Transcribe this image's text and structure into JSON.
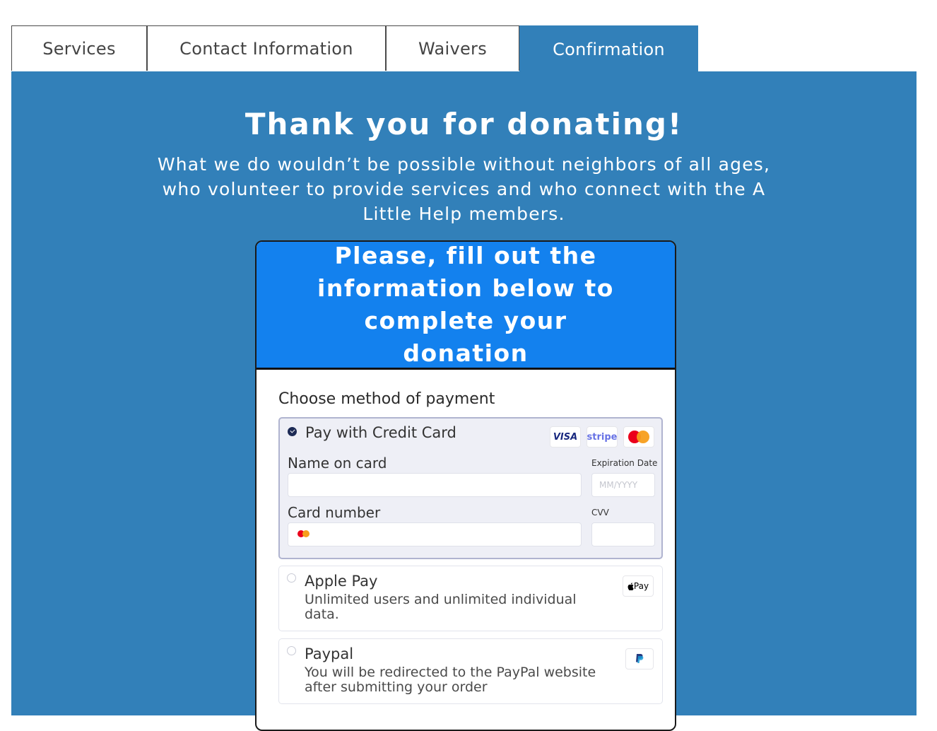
{
  "tabs": [
    {
      "label": "Services",
      "active": false
    },
    {
      "label": "Contact Information",
      "active": false
    },
    {
      "label": "Waivers",
      "active": false
    },
    {
      "label": "Confirmation",
      "active": true
    }
  ],
  "thanks": {
    "title": "Thank you for donating!",
    "subtitle": "What we do wouldn’t be possible without neighbors of all ages, who volunteer to provide services and who connect with the A Little Help members."
  },
  "card": {
    "header": "Please, fill out the information below to complete your donation",
    "choose_label": "Choose method of payment",
    "credit_card": {
      "title": "Pay with Credit Card",
      "badges": [
        "VISA",
        "stripe",
        "mastercard-icon"
      ],
      "name_label": "Name on card",
      "name_value": "",
      "expiration_label": "Expiration Date",
      "expiration_placeholder": "MM/YYYY",
      "card_number_label": "Card number",
      "card_number_value": "",
      "cvv_label": "CVV",
      "cvv_value": ""
    },
    "apple_pay": {
      "title": "Apple Pay",
      "description": "Unlimited users and unlimited individual data.",
      "badge": "Pay"
    },
    "paypal": {
      "title": "Paypal",
      "description": "You will be redirected to the PayPal website after submitting your order"
    }
  },
  "colors": {
    "panel": "#3280b9",
    "card_header": "#1381ee",
    "selected_option_bg": "#eeeff6"
  }
}
